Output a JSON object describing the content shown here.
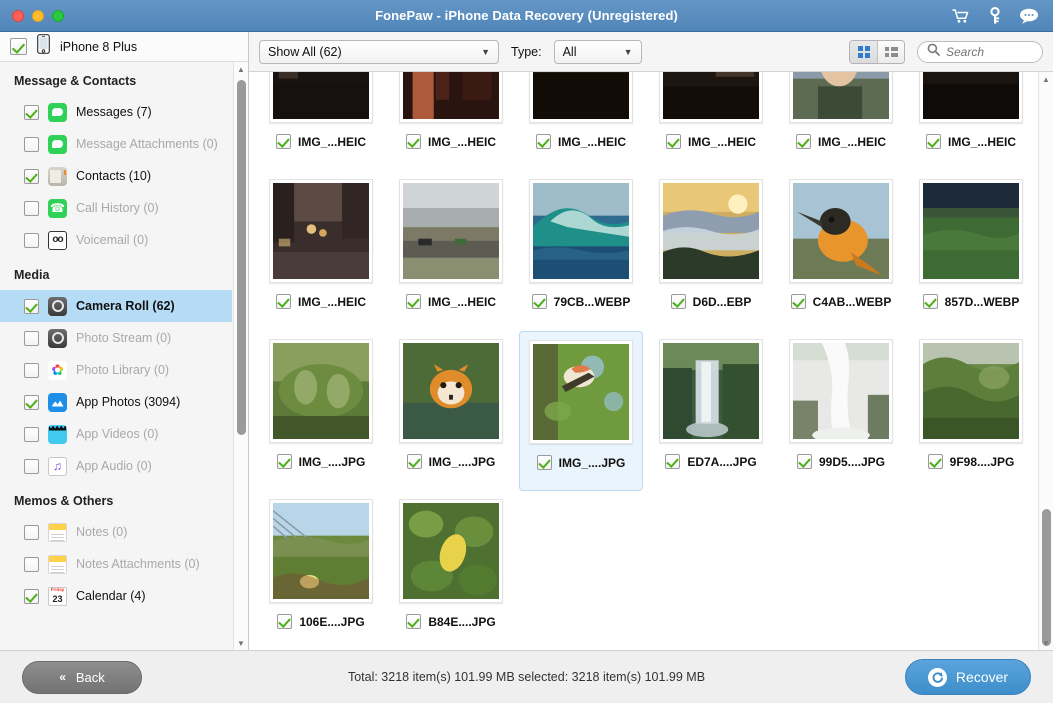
{
  "window": {
    "title": "FonePaw - iPhone Data Recovery (Unregistered)",
    "traffic": {
      "close": "close-button",
      "minimize": "minimize-button",
      "zoom": "zoom-button"
    },
    "icons": [
      "cart-icon",
      "key-icon",
      "chat-icon"
    ]
  },
  "sidebar": {
    "device": {
      "label": "iPhone 8 Plus",
      "checked": true
    },
    "groups": [
      {
        "title": "Message & Contacts",
        "items": [
          {
            "label": "Messages (7)",
            "icon": "messages-icon",
            "checked": true,
            "enabled": true
          },
          {
            "label": "Message Attachments (0)",
            "icon": "message-attachments-icon",
            "checked": false,
            "enabled": false
          },
          {
            "label": "Contacts (10)",
            "icon": "contacts-icon",
            "checked": true,
            "enabled": true
          },
          {
            "label": "Call History (0)",
            "icon": "call-history-icon",
            "checked": false,
            "enabled": false
          },
          {
            "label": "Voicemail (0)",
            "icon": "voicemail-icon",
            "checked": false,
            "enabled": false
          }
        ]
      },
      {
        "title": "Media",
        "items": [
          {
            "label": "Camera Roll (62)",
            "icon": "camera-roll-icon",
            "checked": true,
            "enabled": true,
            "selected": true
          },
          {
            "label": "Photo Stream (0)",
            "icon": "photo-stream-icon",
            "checked": false,
            "enabled": false
          },
          {
            "label": "Photo Library (0)",
            "icon": "photo-library-icon",
            "checked": false,
            "enabled": false
          },
          {
            "label": "App Photos (3094)",
            "icon": "app-photos-icon",
            "checked": true,
            "enabled": true
          },
          {
            "label": "App Videos (0)",
            "icon": "app-videos-icon",
            "checked": false,
            "enabled": false
          },
          {
            "label": "App Audio (0)",
            "icon": "app-audio-icon",
            "checked": false,
            "enabled": false
          }
        ]
      },
      {
        "title": "Memos & Others",
        "items": [
          {
            "label": "Notes (0)",
            "icon": "notes-icon",
            "checked": false,
            "enabled": false
          },
          {
            "label": "Notes Attachments (0)",
            "icon": "notes-attachments-icon",
            "checked": false,
            "enabled": false
          },
          {
            "label": "Calendar (4)",
            "icon": "calendar-icon",
            "checked": true,
            "enabled": true,
            "calendar_top": "Friday",
            "calendar_day": "23"
          }
        ]
      }
    ]
  },
  "toolbar": {
    "filter_value": "Show All (62)",
    "type_label": "Type:",
    "type_value": "All",
    "view_grid": "grid-view",
    "view_list": "list-view",
    "search_placeholder": "Search",
    "search_value": ""
  },
  "grid": {
    "items": [
      {
        "name": "IMG_...HEIC",
        "checked": true,
        "selected": false,
        "thumb": "night-street-1"
      },
      {
        "name": "IMG_...HEIC",
        "checked": true,
        "selected": false,
        "thumb": "night-street-2"
      },
      {
        "name": "IMG_...HEIC",
        "checked": true,
        "selected": false,
        "thumb": "night-street-3"
      },
      {
        "name": "IMG_...HEIC",
        "checked": true,
        "selected": false,
        "thumb": "night-street-4"
      },
      {
        "name": "IMG_...HEIC",
        "checked": true,
        "selected": false,
        "thumb": "person-portrait"
      },
      {
        "name": "IMG_...HEIC",
        "checked": true,
        "selected": false,
        "thumb": "night-street-5"
      },
      {
        "name": "IMG_...HEIC",
        "checked": true,
        "selected": false,
        "thumb": "rainy-street"
      },
      {
        "name": "IMG_...HEIC",
        "checked": true,
        "selected": false,
        "thumb": "city-road"
      },
      {
        "name": "79CB...WEBP",
        "checked": true,
        "selected": false,
        "thumb": "ocean-wave"
      },
      {
        "name": "D6D...EBP",
        "checked": true,
        "selected": false,
        "thumb": "sunset-clouds"
      },
      {
        "name": "C4AB...WEBP",
        "checked": true,
        "selected": false,
        "thumb": "orange-bird"
      },
      {
        "name": "857D...WEBP",
        "checked": true,
        "selected": false,
        "thumb": "green-field-night"
      },
      {
        "name": "IMG_....JPG",
        "checked": true,
        "selected": false,
        "thumb": "plant-leaves"
      },
      {
        "name": "IMG_....JPG",
        "checked": true,
        "selected": false,
        "thumb": "tiger-water"
      },
      {
        "name": "IMG_....JPG",
        "checked": true,
        "selected": true,
        "thumb": "bird-on-tree"
      },
      {
        "name": "ED7A....JPG",
        "checked": true,
        "selected": false,
        "thumb": "waterfall-1"
      },
      {
        "name": "99D5....JPG",
        "checked": true,
        "selected": false,
        "thumb": "waterfall-2"
      },
      {
        "name": "9F98....JPG",
        "checked": true,
        "selected": false,
        "thumb": "mossy-cliff"
      },
      {
        "name": "106E....JPG",
        "checked": true,
        "selected": false,
        "thumb": "succulent-field"
      },
      {
        "name": "B84E....JPG",
        "checked": true,
        "selected": false,
        "thumb": "yellow-leaf"
      }
    ]
  },
  "bottom": {
    "back_label": "Back",
    "total_text": "Total: 3218 item(s) 101.99 MB   selected: 3218 item(s) 101.99 MB",
    "recover_label": "Recover"
  },
  "colors": {
    "titlebar": "#5b8fc0",
    "selection": "#b6dbf5",
    "accent": "#3d8ecb",
    "check": "#4caf15"
  }
}
